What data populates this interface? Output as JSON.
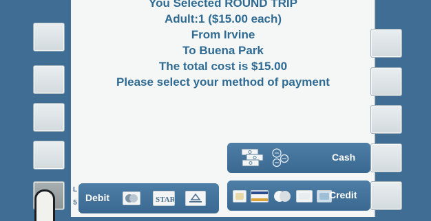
{
  "screen": {
    "lines": [
      "You Selected ROUND TRIP",
      "Adult:1 ($15.00 each)",
      "From Irvine",
      "To Buena Park",
      "The total cost is $15.00",
      "Please select your method of payment"
    ]
  },
  "payment": {
    "cash": {
      "label": "Cash",
      "tag": [
        "R",
        "4"
      ]
    },
    "credit": {
      "label": "Credit",
      "tag": [
        "R",
        "5"
      ]
    },
    "debit": {
      "label": "Debit",
      "tag": [
        "L",
        "5"
      ]
    }
  },
  "icons": {
    "debit": [
      "maestro-icon",
      "star-network-icon",
      "interlink-icon"
    ],
    "credit": [
      "card-generic-icon",
      "visa-icon",
      "mastercard-icon",
      "discover-icon",
      "amex-icon"
    ],
    "cash": [
      "banknotes-icon",
      "coins-icon"
    ]
  },
  "colors": {
    "panel_blue": "#3f6d94",
    "screen_bg": "#f4f7f6",
    "text_blue": "#2f6a93",
    "button_blue": "#4d7ea6"
  }
}
